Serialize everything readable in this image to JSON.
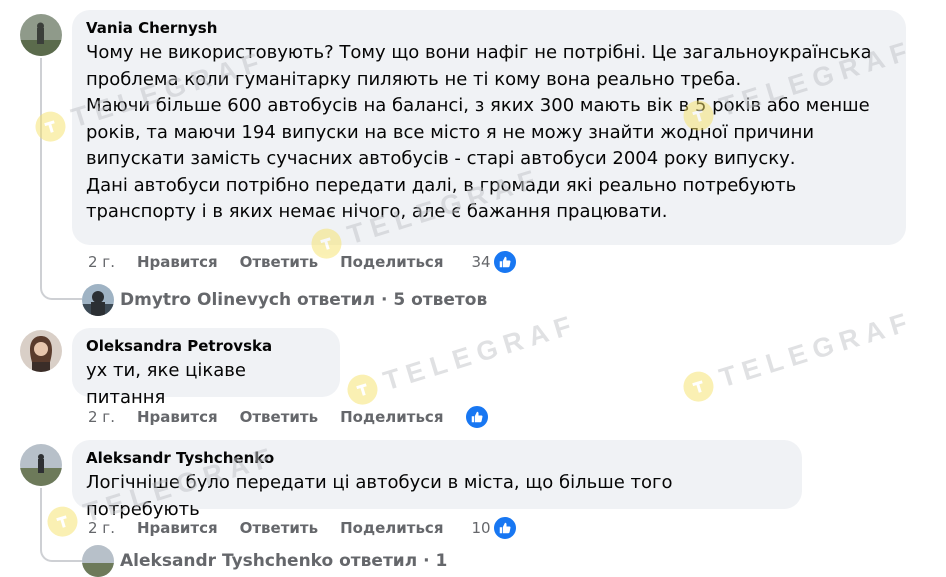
{
  "comments": [
    {
      "author": "Vania Chernysh",
      "text": "Чому не використовують? Тому що вони нафіг не потрібні. Це загальноукраїнська\nпроблема коли гуманітарку пиляють не ті кому вона реально треба.\nМаючи більше 600 автобусів на балансі, з яких 300 мають вік в 5 років або менше\nроків, та маючи 194 випуски на все місто я не можу знайти жодної причини\nвипускати замість сучасних автобусів - старі автобуси 2004 року випуску.\nДані автобуси потрібно передати далі, в громади які реально потребують\nтранспорту і в яких немає нічого, але є бажання працювати.",
      "time": "2 г.",
      "like_label": "Нравится",
      "reply_label": "Ответить",
      "share_label": "Поделиться",
      "likes": "34"
    },
    {
      "author": "Oleksandra Petrovska",
      "text": "ух ти, яке цікаве питання",
      "time": "2 г.",
      "like_label": "Нравится",
      "reply_label": "Ответить",
      "share_label": "Поделиться",
      "likes": ""
    },
    {
      "author": "Aleksandr Tyshchenko",
      "text": "Логічніше було передати ці автобуси в міста, що більше того потребують",
      "time": "2 г.",
      "like_label": "Нравится",
      "reply_label": "Ответить",
      "share_label": "Поделиться",
      "likes": "10"
    }
  ],
  "replies_summary": {
    "text": "Dmytro Olinevych ответил · 5 ответов"
  },
  "partial_reply": {
    "text": "Aleksandr Tyshchenko ответил · 1"
  },
  "watermark": {
    "text": "TELEGRAF"
  },
  "colors": {
    "bubble": "#f0f2f5",
    "meta_text": "#65676b",
    "like_blue": "#1877f2",
    "watermark_logo": "#f7e36a"
  }
}
